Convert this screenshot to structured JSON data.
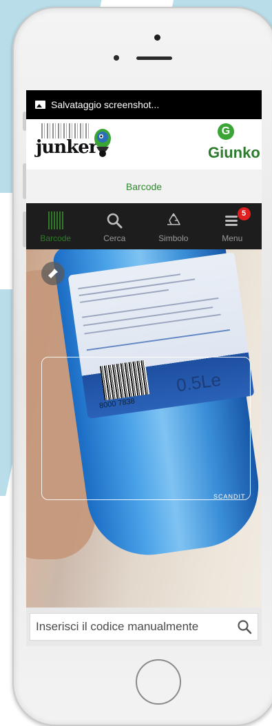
{
  "status_bar": {
    "notification": "Salvataggio screenshot..."
  },
  "header": {
    "left_logo": "junker",
    "right_logo_mark": "G",
    "right_logo": "Giunko"
  },
  "subheader": {
    "title": "Barcode"
  },
  "nav": {
    "items": [
      {
        "label": "Barcode",
        "icon": "barcode-icon",
        "active": true
      },
      {
        "label": "Cerca",
        "icon": "search-icon",
        "active": false
      },
      {
        "label": "Simbolo",
        "icon": "recycle-icon",
        "active": false
      },
      {
        "label": "Menu",
        "icon": "menu-icon",
        "active": false,
        "badge": "5"
      }
    ]
  },
  "camera": {
    "barcode_digits": "8000 7838",
    "volume_text": "0.5Le",
    "watermark": "SCANDIT"
  },
  "search": {
    "placeholder": "Inserisci il codice manualmente"
  },
  "colors": {
    "accent_green": "#2f8a2c",
    "nav_background": "#1d1d1d",
    "badge_red": "#e02020"
  }
}
